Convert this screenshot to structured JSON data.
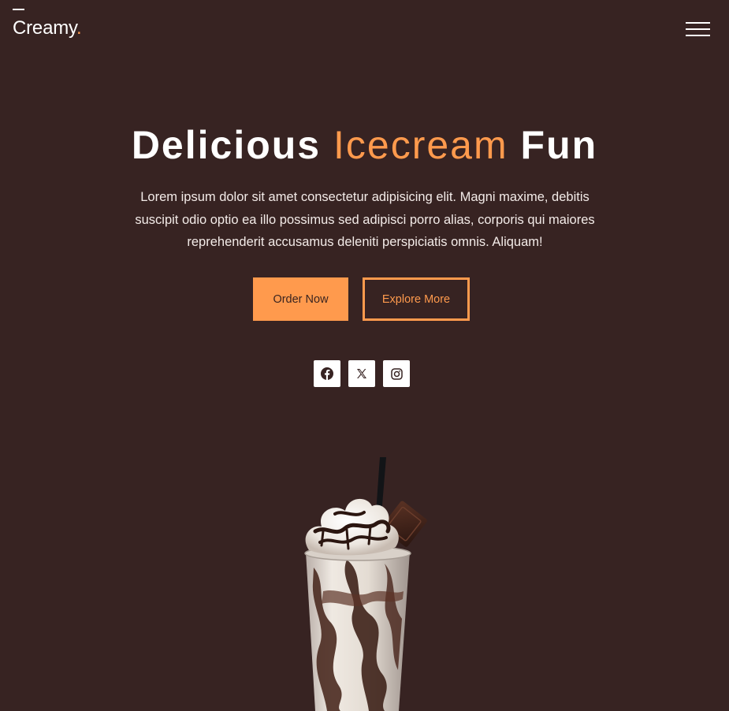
{
  "header": {
    "logo_text": "Creamy",
    "logo_dot": ".",
    "menu_icon": "hamburger-menu-icon"
  },
  "hero": {
    "title_part1": "Delicious",
    "title_accent": "Icecream",
    "title_part2": "Fun",
    "description": "Lorem ipsum dolor sit amet consectetur adipisicing elit. Magni maxime, debitis suscipit odio optio ea illo possimus sed adipisci porro alias, corporis qui maiores reprehenderit accusamus deleniti perspiciatis omnis. Aliquam!",
    "primary_button": "Order Now",
    "secondary_button": "Explore More"
  },
  "social": [
    {
      "icon": "facebook-icon"
    },
    {
      "icon": "x-twitter-icon"
    },
    {
      "icon": "instagram-icon"
    }
  ],
  "colors": {
    "background": "#372322",
    "accent": "#ff9a4d",
    "text": "#ffffff"
  }
}
